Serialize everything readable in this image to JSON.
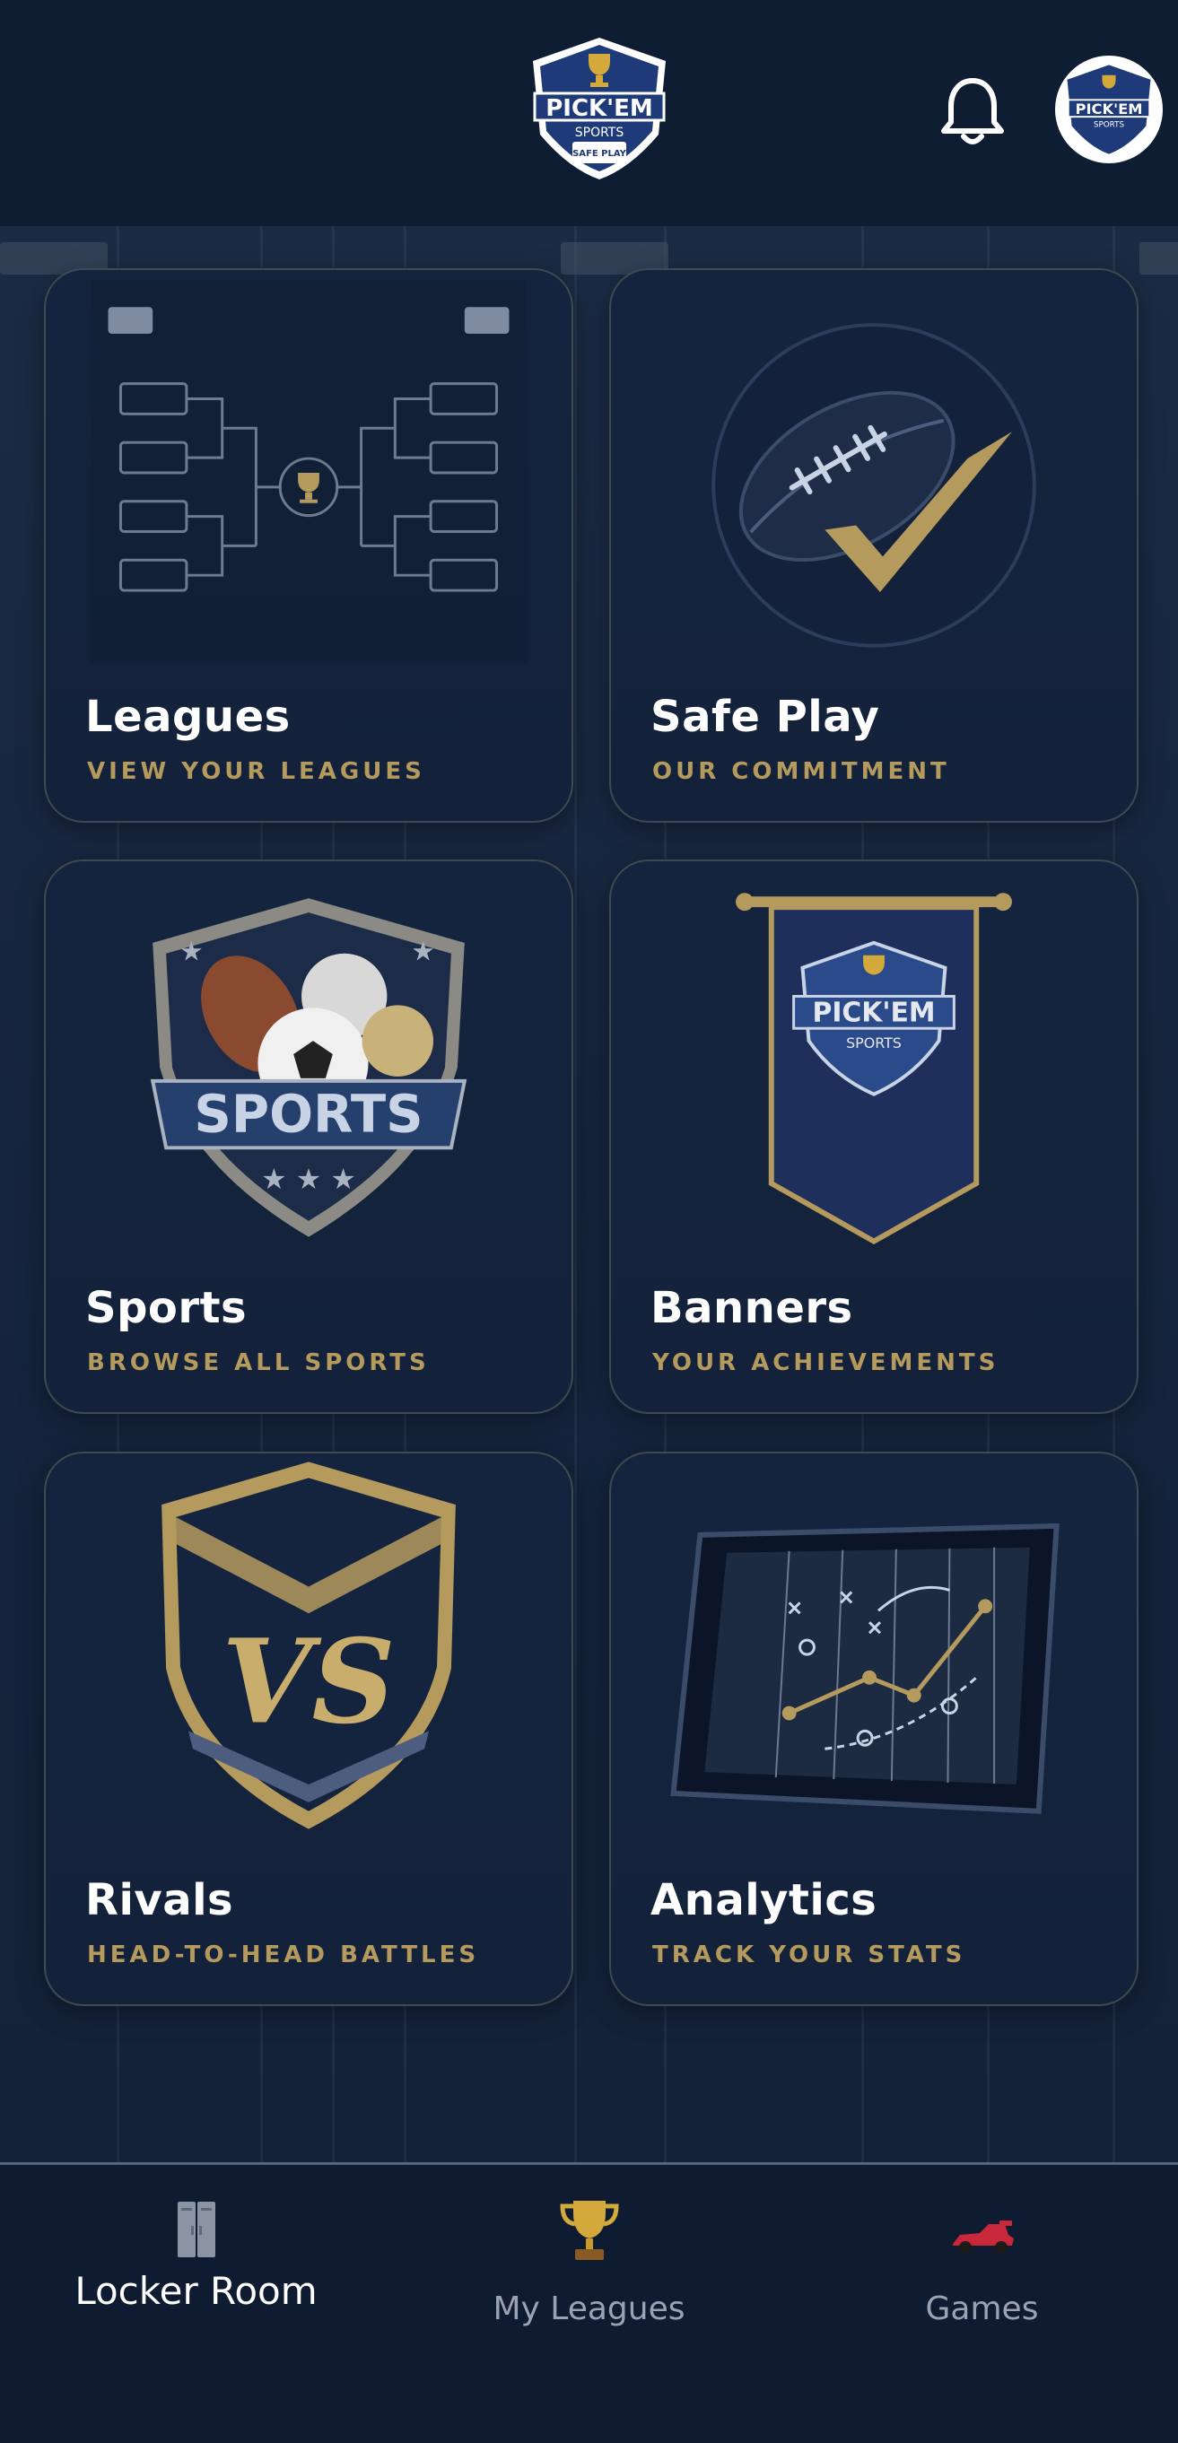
{
  "header": {
    "logo_icon": "pickem-sports-logo-icon",
    "notifications_icon": "bell-icon",
    "avatar_icon": "pickem-sports-logo-icon"
  },
  "cards": [
    {
      "id": "leagues",
      "title": "Leagues",
      "subtitle": "VIEW YOUR LEAGUES",
      "icon": "tournament-bracket-icon"
    },
    {
      "id": "safeplay",
      "title": "Safe Play",
      "subtitle": "OUR COMMITMENT",
      "icon": "football-checkmark-icon"
    },
    {
      "id": "sports",
      "title": "Sports",
      "subtitle": "BROWSE ALL SPORTS",
      "icon": "sports-shield-icon"
    },
    {
      "id": "banners",
      "title": "Banners",
      "subtitle": "YOUR ACHIEVEMENTS",
      "icon": "pennant-banner-icon"
    },
    {
      "id": "rivals",
      "title": "Rivals",
      "subtitle": "HEAD-TO-HEAD BATTLES",
      "icon": "vs-shield-icon"
    },
    {
      "id": "analytics",
      "title": "Analytics",
      "subtitle": "TRACK YOUR STATS",
      "icon": "playbook-tablet-icon"
    }
  ],
  "bottom_nav": [
    {
      "label": "Locker Room",
      "icon": "locker-icon",
      "active": true
    },
    {
      "label": "My Leagues",
      "icon": "trophy-icon",
      "active": false
    },
    {
      "label": "Games",
      "icon": "race-car-icon",
      "active": false
    }
  ],
  "colors": {
    "background": "#0f1d33",
    "card_border": "#3d4a4f",
    "title": "#ffffff",
    "subtitle_gold": "#b59a5e",
    "nav_inactive": "#9ba3b2"
  }
}
